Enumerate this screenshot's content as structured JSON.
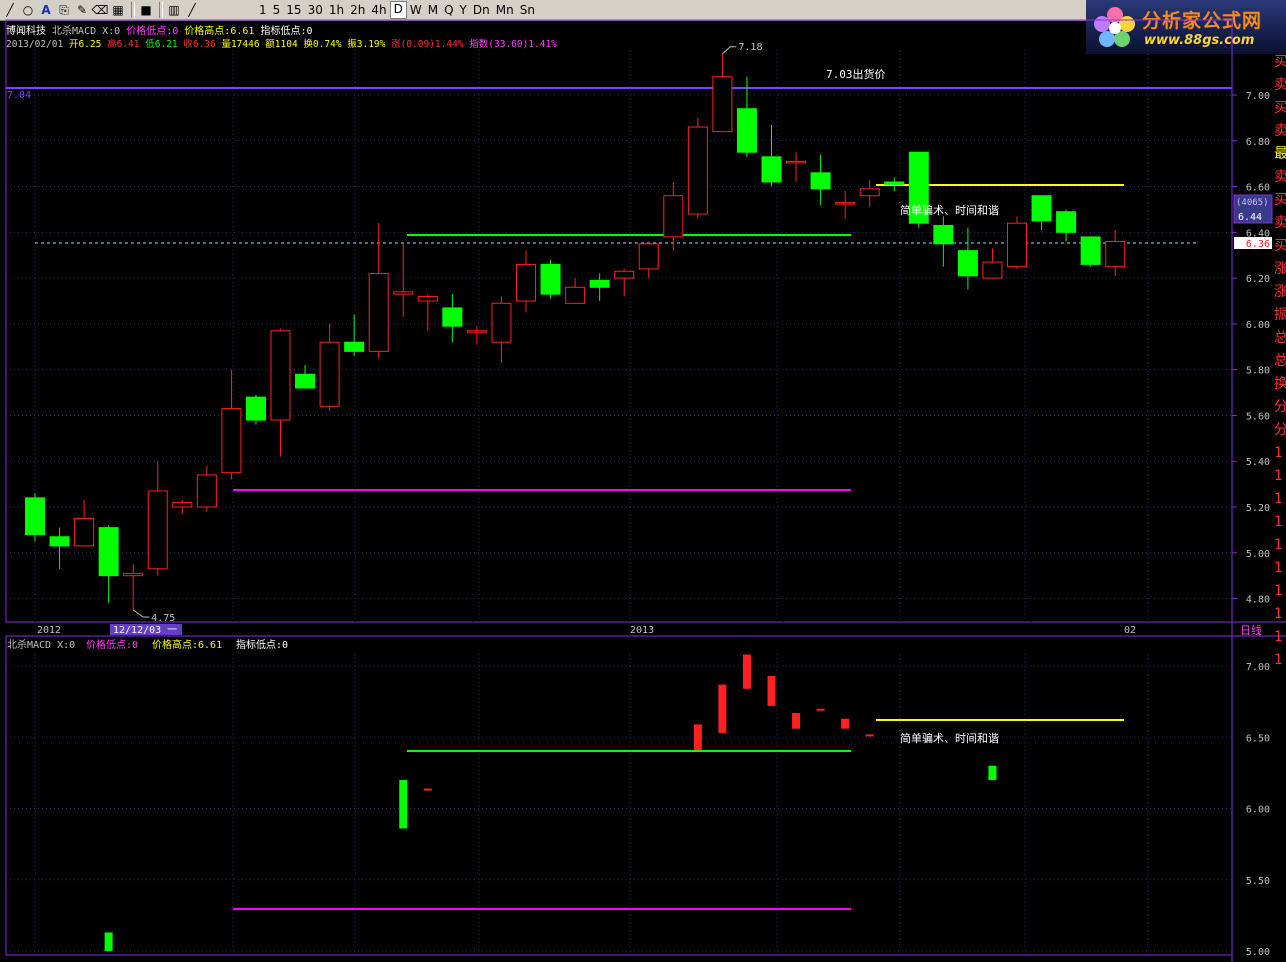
{
  "toolbar": {
    "periods": [
      "1",
      "5",
      "15",
      "30",
      "1h",
      "2h",
      "4h",
      "D",
      "W",
      "M",
      "Q",
      "Y",
      "Dn",
      "Mn",
      "Sn"
    ],
    "active_period": "D"
  },
  "logo": {
    "title": "分析家公式网",
    "url": "www.88gs.com"
  },
  "header": {
    "stock_name": "博闻科技",
    "indicator_line": "北杀MACD X:0",
    "price_low_label": "价格低点:0",
    "price_high_label": "价格高点:6.61",
    "indicator_low_label": "指标低点:0",
    "quote": {
      "date": "2013/02/01",
      "open": "开6.25",
      "high": "高6.41",
      "low": "低6.21",
      "close": "收6.36",
      "volume": "量17446",
      "amount": "额1104",
      "turnover": "换0.74%",
      "amplitude": "振3.19%",
      "change": "涨(0.09)1.44%",
      "index": "指数(33.60)1.41%"
    }
  },
  "main_chart": {
    "price_axis": [
      "7.00",
      "6.80",
      "6.60",
      "6.40",
      "6.20",
      "6.00",
      "5.80",
      "5.60",
      "5.40",
      "5.20",
      "5.00",
      "4.80"
    ],
    "hline_label": "7.04",
    "high_marker": "7.18",
    "low_marker": "4.75",
    "annotation_sell": "7.03出货价",
    "annotation_text": "简单骗术、时间和谐",
    "volume_badge": "(4065)",
    "price_badge_1": "6.44",
    "price_badge_2": "6.36",
    "right_panel_chars": [
      "买",
      "卖",
      "买",
      "卖",
      "最",
      "卖",
      "买",
      "卖",
      "买",
      "涨",
      "涨",
      "振",
      "总",
      "总",
      "换",
      "分",
      "分",
      "1",
      "1",
      "1",
      "1",
      "1",
      "1",
      "1",
      "1",
      "1",
      "1"
    ]
  },
  "time_axis": {
    "labels": [
      "2012",
      "12/12/03 一",
      "2013",
      "02"
    ],
    "period_label": "日线"
  },
  "sub_chart": {
    "header_indicator": "北杀MACD X:0",
    "header_low": "价格低点:0",
    "header_high": "价格高点:6.61",
    "header_ind_low": "指标低点:0",
    "axis": [
      "7.00",
      "6.50",
      "6.00",
      "5.50",
      "5.00"
    ],
    "annotation_text": "简单骗术、时间和谐"
  },
  "colors": {
    "up": "#ff2020",
    "down": "#00ff00",
    "magenta": "#ff00ff",
    "yellow": "#ffff00",
    "purple": "#8040ff",
    "green_line": "#00ff00"
  },
  "candles": [
    {
      "o": 5.24,
      "h": 5.26,
      "l": 5.05,
      "c": 5.08
    },
    {
      "o": 5.07,
      "h": 5.11,
      "l": 4.93,
      "c": 5.03
    },
    {
      "o": 5.03,
      "h": 5.23,
      "l": 5.03,
      "c": 5.15
    },
    {
      "o": 5.11,
      "h": 5.12,
      "l": 4.78,
      "c": 4.9
    },
    {
      "o": 4.9,
      "h": 4.95,
      "l": 4.75,
      "c": 4.91
    },
    {
      "o": 4.93,
      "h": 5.4,
      "l": 4.9,
      "c": 5.27
    },
    {
      "o": 5.2,
      "h": 5.23,
      "l": 5.17,
      "c": 5.22
    },
    {
      "o": 5.2,
      "h": 5.38,
      "l": 5.18,
      "c": 5.34
    },
    {
      "o": 5.35,
      "h": 5.8,
      "l": 5.32,
      "c": 5.63
    },
    {
      "o": 5.68,
      "h": 5.69,
      "l": 5.56,
      "c": 5.58
    },
    {
      "o": 5.58,
      "h": 5.98,
      "l": 5.42,
      "c": 5.97
    },
    {
      "o": 5.78,
      "h": 5.82,
      "l": 5.72,
      "c": 5.72
    },
    {
      "o": 5.64,
      "h": 6.0,
      "l": 5.62,
      "c": 5.92
    },
    {
      "o": 5.92,
      "h": 6.04,
      "l": 5.86,
      "c": 5.88
    },
    {
      "o": 5.88,
      "h": 6.44,
      "l": 5.85,
      "c": 6.22
    },
    {
      "o": 6.13,
      "h": 6.35,
      "l": 6.03,
      "c": 6.14
    },
    {
      "o": 6.1,
      "h": 6.13,
      "l": 5.97,
      "c": 6.12
    },
    {
      "o": 6.07,
      "h": 6.13,
      "l": 5.92,
      "c": 5.99
    },
    {
      "o": 5.97,
      "h": 5.99,
      "l": 5.91,
      "c": 5.97
    },
    {
      "o": 5.92,
      "h": 6.12,
      "l": 5.83,
      "c": 6.09
    },
    {
      "o": 6.1,
      "h": 6.32,
      "l": 6.05,
      "c": 6.26
    },
    {
      "o": 6.26,
      "h": 6.28,
      "l": 6.11,
      "c": 6.13
    },
    {
      "o": 6.09,
      "h": 6.2,
      "l": 6.09,
      "c": 6.16
    },
    {
      "o": 6.19,
      "h": 6.22,
      "l": 6.1,
      "c": 6.16
    },
    {
      "o": 6.2,
      "h": 6.24,
      "l": 6.12,
      "c": 6.23
    },
    {
      "o": 6.24,
      "h": 6.36,
      "l": 6.2,
      "c": 6.35
    },
    {
      "o": 6.38,
      "h": 6.62,
      "l": 6.32,
      "c": 6.56
    },
    {
      "o": 6.48,
      "h": 6.9,
      "l": 6.46,
      "c": 6.86
    },
    {
      "o": 6.84,
      "h": 7.18,
      "l": 6.84,
      "c": 7.08
    },
    {
      "o": 6.94,
      "h": 7.08,
      "l": 6.73,
      "c": 6.75
    },
    {
      "o": 6.73,
      "h": 6.87,
      "l": 6.6,
      "c": 6.62
    },
    {
      "o": 6.71,
      "h": 6.75,
      "l": 6.62,
      "c": 6.71
    },
    {
      "o": 6.66,
      "h": 6.74,
      "l": 6.52,
      "c": 6.59
    },
    {
      "o": 6.53,
      "h": 6.58,
      "l": 6.46,
      "c": 6.53
    },
    {
      "o": 6.56,
      "h": 6.63,
      "l": 6.51,
      "c": 6.59
    },
    {
      "o": 6.62,
      "h": 6.64,
      "l": 6.58,
      "c": 6.61
    },
    {
      "o": 6.75,
      "h": 6.75,
      "l": 6.42,
      "c": 6.44
    },
    {
      "o": 6.43,
      "h": 6.47,
      "l": 6.25,
      "c": 6.35
    },
    {
      "o": 6.32,
      "h": 6.42,
      "l": 6.15,
      "c": 6.21
    },
    {
      "o": 6.2,
      "h": 6.33,
      "l": 6.2,
      "c": 6.27
    },
    {
      "o": 6.25,
      "h": 6.47,
      "l": 6.24,
      "c": 6.44
    },
    {
      "o": 6.56,
      "h": 6.56,
      "l": 6.41,
      "c": 6.45
    },
    {
      "o": 6.49,
      "h": 6.5,
      "l": 6.36,
      "c": 6.4
    },
    {
      "o": 6.38,
      "h": 6.38,
      "l": 6.25,
      "c": 6.26
    },
    {
      "o": 6.25,
      "h": 6.41,
      "l": 6.21,
      "c": 6.36
    }
  ],
  "sub_bars": [
    {
      "i": 3,
      "v1": 5.13,
      "v2": 5.0,
      "up": false
    },
    {
      "i": 15,
      "v1": 6.2,
      "v2": 5.86,
      "up": false
    },
    {
      "i": 16,
      "v1": 6.14,
      "v2": 6.13,
      "up": true
    },
    {
      "i": 27,
      "v1": 6.59,
      "v2": 6.41,
      "up": true
    },
    {
      "i": 28,
      "v1": 6.87,
      "v2": 6.53,
      "up": true
    },
    {
      "i": 29,
      "v1": 7.08,
      "v2": 6.84,
      "up": true
    },
    {
      "i": 30,
      "v1": 6.93,
      "v2": 6.72,
      "up": true
    },
    {
      "i": 31,
      "v1": 6.67,
      "v2": 6.56,
      "up": true
    },
    {
      "i": 32,
      "v1": 6.7,
      "v2": 6.69,
      "up": true
    },
    {
      "i": 33,
      "v1": 6.63,
      "v2": 6.56,
      "up": true
    },
    {
      "i": 34,
      "v1": 6.52,
      "v2": 6.51,
      "up": true
    },
    {
      "i": 39,
      "v1": 6.3,
      "v2": 6.2,
      "up": false
    }
  ]
}
